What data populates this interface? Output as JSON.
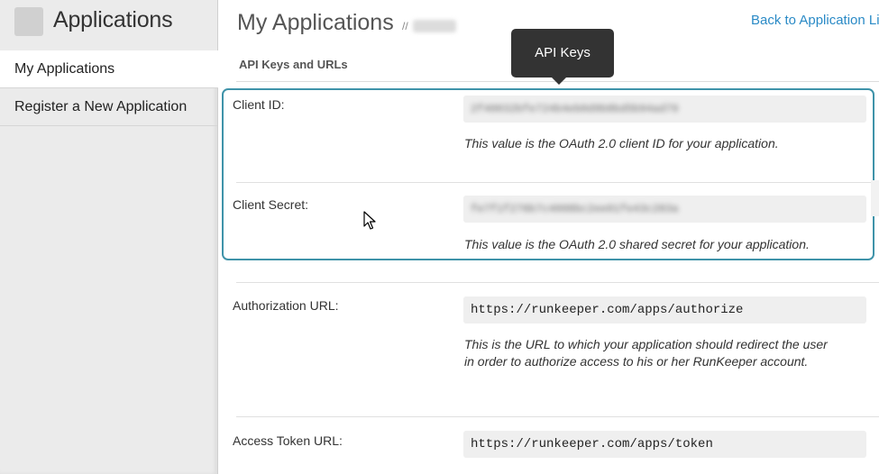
{
  "sidebar": {
    "title": "Applications",
    "items": [
      {
        "label": "My Applications",
        "active": true
      },
      {
        "label": "Register a New Application",
        "active": false
      }
    ]
  },
  "header": {
    "title": "My Applications",
    "subtitle_prefix": "//",
    "back_link": "Back to Application Li"
  },
  "section": {
    "title": "API Keys and URLs"
  },
  "tooltip": {
    "label": "API Keys"
  },
  "fields": {
    "client_id": {
      "label": "Client ID:",
      "value": "2f40032bfe724b4eb0d9b8bd5b94ad79",
      "help": "This value is the OAuth 2.0 client ID for your application."
    },
    "client_secret": {
      "label": "Client Secret:",
      "value": "fe7f1f276b7c4008bc2ee01fe43c283a",
      "help": "This value is the OAuth 2.0 shared secret for your application."
    },
    "authorization_url": {
      "label": "Authorization URL:",
      "value": "https://runkeeper.com/apps/authorize",
      "help": "This is the URL to which your application should redirect the user in order to authorize access to his or her RunKeeper account."
    },
    "access_token_url": {
      "label": "Access Token URL:",
      "value": "https://runkeeper.com/apps/token"
    }
  },
  "colors": {
    "highlight_border": "#3f93a9",
    "link": "#2a8ac6",
    "tooltip_bg": "#333333",
    "sidebar_bg": "#ebebeb"
  }
}
